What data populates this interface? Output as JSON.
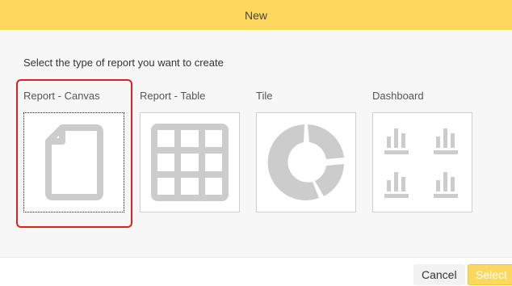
{
  "dialog": {
    "title": "New",
    "prompt": "Select the type of report you want to create",
    "options": [
      {
        "label": "Report - Canvas",
        "icon": "document-icon",
        "selected": true
      },
      {
        "label": "Report - Table",
        "icon": "table-grid-icon",
        "selected": false
      },
      {
        "label": "Tile",
        "icon": "donut-chart-icon",
        "selected": false
      },
      {
        "label": "Dashboard",
        "icon": "dashboard-bars-icon",
        "selected": false
      }
    ],
    "buttons": {
      "cancel": "Cancel",
      "select": "Select"
    }
  },
  "colors": {
    "header": "#fdd85d",
    "icon_gray": "#cccccc",
    "highlight": "#e02020"
  }
}
